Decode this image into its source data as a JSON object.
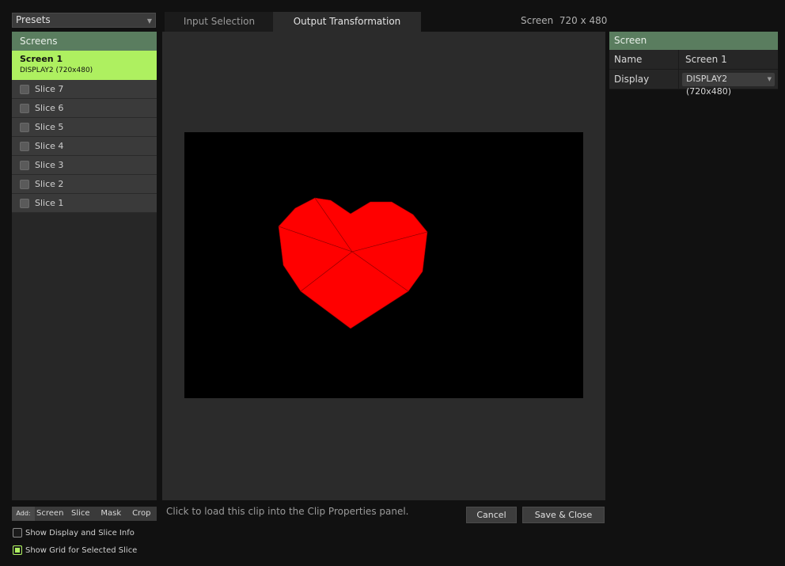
{
  "presets": {
    "label": "Presets"
  },
  "tabs": {
    "input_selection": "Input Selection",
    "output_transformation": "Output Transformation"
  },
  "screen_info": "Screen  720 x 480",
  "screens_panel": {
    "header": "Screens",
    "screen": {
      "name": "Screen 1",
      "display": "DISPLAY2 (720x480)"
    },
    "slices": [
      "Slice 7",
      "Slice 6",
      "Slice 5",
      "Slice 4",
      "Slice 3",
      "Slice 2",
      "Slice 1"
    ]
  },
  "properties": {
    "header": "Screen",
    "name_label": "Name",
    "name_value": "Screen 1",
    "display_label": "Display",
    "display_value": "DISPLAY2 (720x480)"
  },
  "add_bar": {
    "label": "Add:",
    "buttons": [
      "Screen",
      "Slice",
      "Mask",
      "Crop"
    ]
  },
  "status_text": "Click to load this clip into the Clip Properties panel.",
  "buttons": {
    "cancel": "Cancel",
    "save_close": "Save & Close"
  },
  "options": {
    "show_display_info": {
      "label": "Show Display and Slice Info",
      "checked": false
    },
    "show_grid": {
      "label": "Show Grid for Selected Slice",
      "checked": true
    }
  },
  "colors": {
    "accent": "#aef060",
    "header": "#5a7d5f",
    "heart": "#ff0000"
  }
}
